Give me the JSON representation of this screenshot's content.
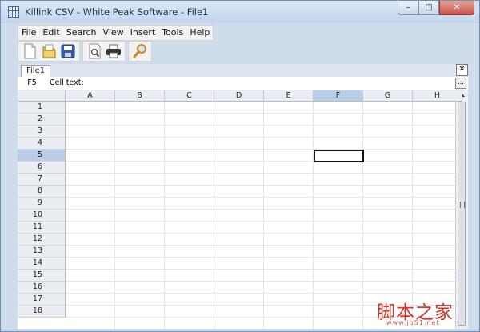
{
  "window": {
    "title": "Killink CSV - White Peak Software - File1",
    "controls": [
      "–",
      "□",
      "✕"
    ]
  },
  "menu": [
    "File",
    "Edit",
    "Search",
    "View",
    "Insert",
    "Tools",
    "Help"
  ],
  "toolbar": {
    "groups": [
      [
        {
          "name": "new-file-icon"
        },
        {
          "name": "open-folder-icon"
        },
        {
          "name": "save-icon"
        }
      ],
      [
        {
          "name": "print-preview-icon"
        },
        {
          "name": "print-icon"
        }
      ],
      [
        {
          "name": "search-icon"
        }
      ]
    ]
  },
  "tabs": [
    {
      "label": "File1"
    }
  ],
  "tab_close": "✕",
  "cell_bar": {
    "ref": "F5",
    "label": "Cell text:",
    "value": "",
    "more": "..."
  },
  "grid": {
    "columns": [
      "A",
      "B",
      "C",
      "D",
      "E",
      "F",
      "G",
      "H"
    ],
    "rows": [
      "1",
      "2",
      "3",
      "4",
      "5",
      "6",
      "7",
      "8",
      "9",
      "10",
      "11",
      "12",
      "13",
      "14",
      "15",
      "16",
      "17",
      "18"
    ],
    "selected_column": "F",
    "selected_row": "5"
  },
  "watermark": {
    "text": "脚本之家",
    "sub": "www.jb51.net"
  },
  "colors": {
    "accent": "#b7cde8",
    "frame": "#cfdcec",
    "watermark": "#cf3a2a"
  }
}
